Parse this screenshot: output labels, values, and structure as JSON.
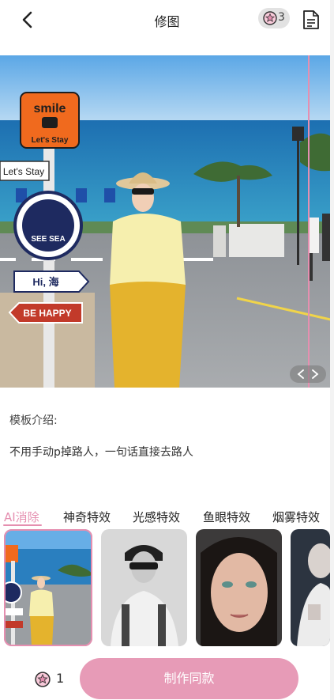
{
  "header": {
    "title": "修图",
    "credits": "3"
  },
  "photo": {
    "sign_smile": "smile",
    "sign_lets_stay": "Let's Stay",
    "sign_lets_stay_side": "Let's Stay",
    "badge_text": "SEE SEA",
    "sign_hi": "Hi, 海",
    "sign_happy": "BE HAPPY"
  },
  "intro": {
    "label": "模板介绍:",
    "description": "不用手动p掉路人，一句话直接去路人"
  },
  "tabs": [
    {
      "label": "AI消除",
      "active": true
    },
    {
      "label": "神奇特效",
      "active": false
    },
    {
      "label": "光感特效",
      "active": false
    },
    {
      "label": "鱼眼特效",
      "active": false
    },
    {
      "label": "烟雾特效",
      "active": false
    }
  ],
  "bottom": {
    "credits": "1",
    "make_button": "制作同款"
  },
  "colors": {
    "accent": "#e58fb0",
    "button": "#e79bb7"
  },
  "icons": [
    "back-arrow-icon",
    "credit-star-icon",
    "document-icon",
    "compare-arrows-icon"
  ]
}
